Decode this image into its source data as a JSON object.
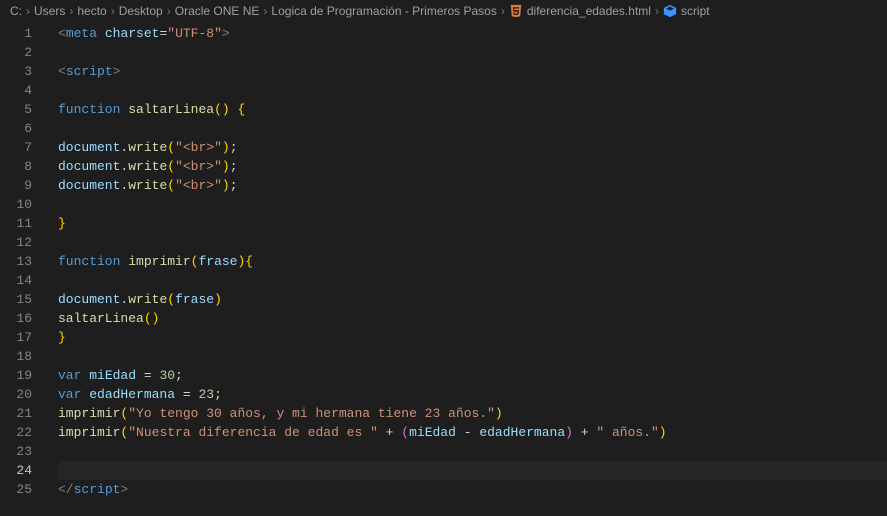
{
  "breadcrumb": {
    "items": [
      {
        "label": "C:"
      },
      {
        "label": "Users"
      },
      {
        "label": "hecto"
      },
      {
        "label": "Desktop"
      },
      {
        "label": "Oracle ONE NE"
      },
      {
        "label": "Logica de Programación - Primeros Pasos"
      },
      {
        "label": "diferencia_edades.html",
        "icon": "html"
      },
      {
        "label": "script",
        "icon": "symbol"
      }
    ]
  },
  "editor": {
    "active_line": 24,
    "lines": [
      {
        "n": 1,
        "tokens": [
          [
            "pun2",
            "<"
          ],
          [
            "tag",
            "meta"
          ],
          [
            "pun",
            " "
          ],
          [
            "attr",
            "charset"
          ],
          [
            "pun",
            "="
          ],
          [
            "str",
            "\"UTF-8\""
          ],
          [
            "pun2",
            ">"
          ]
        ]
      },
      {
        "n": 2,
        "tokens": []
      },
      {
        "n": 3,
        "tokens": [
          [
            "pun2",
            "<"
          ],
          [
            "tag",
            "script"
          ],
          [
            "pun2",
            ">"
          ]
        ]
      },
      {
        "n": 4,
        "tokens": []
      },
      {
        "n": 5,
        "tokens": [
          [
            "kw",
            "function"
          ],
          [
            "pun",
            " "
          ],
          [
            "fn",
            "saltarLinea"
          ],
          [
            "brace-y",
            "("
          ],
          [
            "brace-y",
            ")"
          ],
          [
            "pun",
            " "
          ],
          [
            "brace-y",
            "{"
          ]
        ]
      },
      {
        "n": 6,
        "tokens": []
      },
      {
        "n": 7,
        "tokens": [
          [
            "attr",
            "document"
          ],
          [
            "pun",
            "."
          ],
          [
            "fn",
            "write"
          ],
          [
            "brace-y",
            "("
          ],
          [
            "str",
            "\"<br>\""
          ],
          [
            "brace-y",
            ")"
          ],
          [
            "pun",
            ";"
          ]
        ]
      },
      {
        "n": 8,
        "tokens": [
          [
            "attr",
            "document"
          ],
          [
            "pun",
            "."
          ],
          [
            "fn",
            "write"
          ],
          [
            "brace-y",
            "("
          ],
          [
            "str",
            "\"<br>\""
          ],
          [
            "brace-y",
            ")"
          ],
          [
            "pun",
            ";"
          ]
        ]
      },
      {
        "n": 9,
        "tokens": [
          [
            "attr",
            "document"
          ],
          [
            "pun",
            "."
          ],
          [
            "fn",
            "write"
          ],
          [
            "brace-y",
            "("
          ],
          [
            "str",
            "\"<br>\""
          ],
          [
            "brace-y",
            ")"
          ],
          [
            "pun",
            ";"
          ]
        ]
      },
      {
        "n": 10,
        "tokens": []
      },
      {
        "n": 11,
        "tokens": [
          [
            "brace-y",
            "}"
          ]
        ]
      },
      {
        "n": 12,
        "tokens": []
      },
      {
        "n": 13,
        "tokens": [
          [
            "kw",
            "function"
          ],
          [
            "pun",
            " "
          ],
          [
            "fn",
            "imprimir"
          ],
          [
            "brace-y",
            "("
          ],
          [
            "attr",
            "frase"
          ],
          [
            "brace-y",
            ")"
          ],
          [
            "brace-y",
            "{"
          ]
        ]
      },
      {
        "n": 14,
        "tokens": []
      },
      {
        "n": 15,
        "tokens": [
          [
            "attr",
            "document"
          ],
          [
            "pun",
            "."
          ],
          [
            "fn",
            "write"
          ],
          [
            "brace-y",
            "("
          ],
          [
            "attr",
            "frase"
          ],
          [
            "brace-y",
            ")"
          ]
        ]
      },
      {
        "n": 16,
        "tokens": [
          [
            "fn",
            "saltarLinea"
          ],
          [
            "brace-y",
            "("
          ],
          [
            "brace-y",
            ")"
          ]
        ]
      },
      {
        "n": 17,
        "tokens": [
          [
            "brace-y",
            "}"
          ]
        ]
      },
      {
        "n": 18,
        "tokens": []
      },
      {
        "n": 19,
        "tokens": [
          [
            "kw",
            "var"
          ],
          [
            "pun",
            " "
          ],
          [
            "attr",
            "miEdad"
          ],
          [
            "pun",
            " = "
          ],
          [
            "num",
            "30"
          ],
          [
            "pun",
            ";"
          ]
        ]
      },
      {
        "n": 20,
        "tokens": [
          [
            "kw",
            "var"
          ],
          [
            "pun",
            " "
          ],
          [
            "attr",
            "edadHermana"
          ],
          [
            "pun",
            " = "
          ],
          [
            "num",
            "23"
          ],
          [
            "pun",
            ";"
          ]
        ]
      },
      {
        "n": 21,
        "tokens": [
          [
            "fn",
            "imprimir"
          ],
          [
            "brace-y",
            "("
          ],
          [
            "str",
            "\"Yo tengo 30 años, y mi hermana tiene 23 años.\""
          ],
          [
            "brace-y",
            ")"
          ]
        ]
      },
      {
        "n": 22,
        "tokens": [
          [
            "fn",
            "imprimir"
          ],
          [
            "brace-y",
            "("
          ],
          [
            "str",
            "\"Nuestra diferencia de edad es \""
          ],
          [
            "pun",
            " + "
          ],
          [
            "brace-p",
            "("
          ],
          [
            "attr",
            "miEdad"
          ],
          [
            "pun",
            " - "
          ],
          [
            "attr",
            "edadHermana"
          ],
          [
            "brace-p",
            ")"
          ],
          [
            "pun",
            " + "
          ],
          [
            "str",
            "\" años.\""
          ],
          [
            "brace-y",
            ")"
          ]
        ]
      },
      {
        "n": 23,
        "tokens": []
      },
      {
        "n": 24,
        "tokens": []
      },
      {
        "n": 25,
        "tokens": [
          [
            "pun2",
            "</"
          ],
          [
            "tag",
            "script"
          ],
          [
            "pun2",
            ">"
          ]
        ]
      }
    ]
  }
}
